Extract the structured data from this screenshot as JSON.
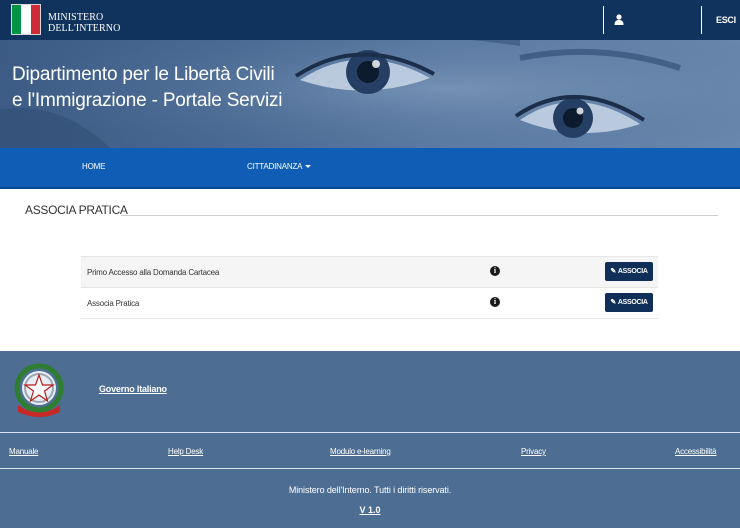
{
  "header": {
    "ministry_line1": "MINISTERO",
    "ministry_line2": "DELL'INTERNO",
    "user_icon": "user-icon",
    "logout_label": "ESCI",
    "flag_colors": [
      "#009246",
      "#ffffff",
      "#ce2b37"
    ]
  },
  "hero": {
    "title_line1": "Dipartimento per le Libertà Civili",
    "title_line2": "e l'Immigrazione - Portale Servizi"
  },
  "nav": {
    "home_label": "HOME",
    "cittadinanza_label": "CITTADINANZA"
  },
  "main": {
    "section_title": "ASSOCIA PRATICA",
    "rows": [
      {
        "label": "Primo Accesso alla Domanda Cartacea",
        "button_label": "ASSOCIA"
      },
      {
        "label": "Associa Pratica",
        "button_label": "ASSOCIA"
      }
    ]
  },
  "footer": {
    "gov_link": "Governo Italiano",
    "links": {
      "manuale": "Manuale",
      "help_desk": "Help Desk",
      "modulo": "Modulo e-learning",
      "privacy": "Privacy",
      "accessibilita": "Accessibilità"
    },
    "copyright": "Ministero dell'Interno. Tutti i diritti riservati.",
    "version": "V 1.0"
  },
  "colors": {
    "topbar": "#10335e",
    "navbar": "#0f5db5",
    "button": "#0f2f59",
    "footer": "#4d6e92"
  }
}
